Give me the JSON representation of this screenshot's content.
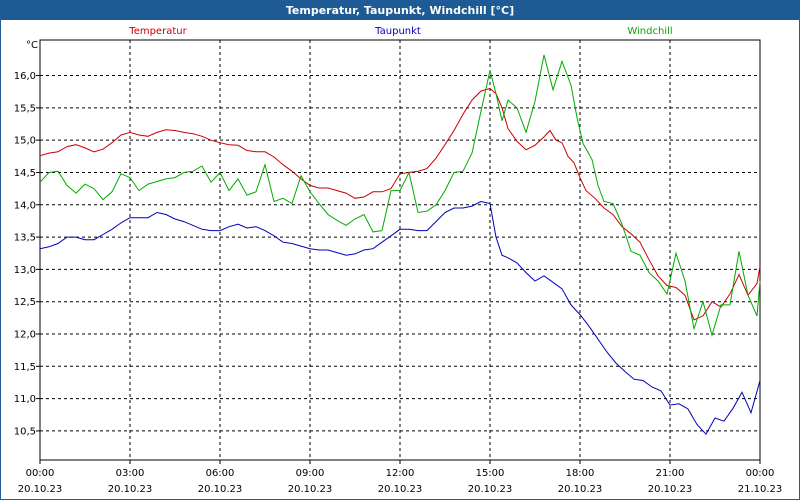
{
  "window": {
    "title": "Temperatur, Taupunkt, Windchill [°C]"
  },
  "chart_data": {
    "type": "line",
    "title": "Temperatur, Taupunkt, Windchill [°C]",
    "ylabel": "°C",
    "ylim": [
      10.05,
      16.55
    ],
    "yticks": [
      10.5,
      11.0,
      11.5,
      12.0,
      12.5,
      13.0,
      13.5,
      14.0,
      14.5,
      15.0,
      15.5,
      16.0
    ],
    "ytick_labels": [
      "10,5",
      "11,0",
      "11,5",
      "12,0",
      "12,5",
      "13,0",
      "13,5",
      "14,0",
      "14,5",
      "15,0",
      "15,5",
      "16,0"
    ],
    "xlim": [
      0,
      24
    ],
    "xticks": [
      0,
      3,
      6,
      9,
      12,
      15,
      18,
      21,
      24
    ],
    "xtick_labels": [
      {
        "time": "00:00",
        "date": "20.10.23"
      },
      {
        "time": "03:00",
        "date": "20.10.23"
      },
      {
        "time": "06:00",
        "date": "20.10.23"
      },
      {
        "time": "09:00",
        "date": "20.10.23"
      },
      {
        "time": "12:00",
        "date": "20.10.23"
      },
      {
        "time": "15:00",
        "date": "20.10.23"
      },
      {
        "time": "18:00",
        "date": "20.10.23"
      },
      {
        "time": "21:00",
        "date": "20.10.23"
      },
      {
        "time": "00:00",
        "date": "21.10.23"
      }
    ],
    "grid": true,
    "legend_position": "top",
    "series": [
      {
        "name": "Temperatur",
        "color": "#cc0000",
        "points": [
          [
            0.0,
            14.76
          ],
          [
            0.3,
            14.8
          ],
          [
            0.6,
            14.82
          ],
          [
            0.9,
            14.9
          ],
          [
            1.2,
            14.93
          ],
          [
            1.5,
            14.88
          ],
          [
            1.8,
            14.82
          ],
          [
            2.1,
            14.86
          ],
          [
            2.4,
            14.96
          ],
          [
            2.7,
            15.08
          ],
          [
            3.0,
            15.12
          ],
          [
            3.3,
            15.08
          ],
          [
            3.6,
            15.06
          ],
          [
            3.9,
            15.12
          ],
          [
            4.2,
            15.16
          ],
          [
            4.5,
            15.15
          ],
          [
            4.8,
            15.12
          ],
          [
            5.1,
            15.1
          ],
          [
            5.4,
            15.06
          ],
          [
            5.7,
            15.0
          ],
          [
            6.0,
            14.96
          ],
          [
            6.3,
            14.93
          ],
          [
            6.6,
            14.92
          ],
          [
            6.9,
            14.84
          ],
          [
            7.2,
            14.82
          ],
          [
            7.5,
            14.82
          ],
          [
            7.8,
            14.74
          ],
          [
            8.1,
            14.62
          ],
          [
            8.4,
            14.52
          ],
          [
            8.7,
            14.4
          ],
          [
            9.0,
            14.3
          ],
          [
            9.3,
            14.26
          ],
          [
            9.6,
            14.26
          ],
          [
            9.9,
            14.22
          ],
          [
            10.2,
            14.18
          ],
          [
            10.5,
            14.1
          ],
          [
            10.8,
            14.12
          ],
          [
            11.1,
            14.2
          ],
          [
            11.4,
            14.2
          ],
          [
            11.7,
            14.25
          ],
          [
            12.0,
            14.48
          ],
          [
            12.3,
            14.5
          ],
          [
            12.6,
            14.52
          ],
          [
            12.9,
            14.56
          ],
          [
            13.2,
            14.72
          ],
          [
            13.5,
            14.93
          ],
          [
            13.8,
            15.15
          ],
          [
            14.1,
            15.4
          ],
          [
            14.4,
            15.62
          ],
          [
            14.7,
            15.76
          ],
          [
            15.0,
            15.8
          ],
          [
            15.2,
            15.72
          ],
          [
            15.4,
            15.5
          ],
          [
            15.6,
            15.18
          ],
          [
            15.9,
            14.98
          ],
          [
            16.2,
            14.85
          ],
          [
            16.5,
            14.92
          ],
          [
            16.8,
            15.05
          ],
          [
            17.0,
            15.15
          ],
          [
            17.2,
            15.0
          ],
          [
            17.4,
            14.96
          ],
          [
            17.6,
            14.75
          ],
          [
            17.8,
            14.65
          ],
          [
            18.0,
            14.42
          ],
          [
            18.2,
            14.22
          ],
          [
            18.5,
            14.1
          ],
          [
            18.8,
            13.95
          ],
          [
            19.1,
            13.85
          ],
          [
            19.4,
            13.66
          ],
          [
            19.7,
            13.55
          ],
          [
            20.0,
            13.42
          ],
          [
            20.3,
            13.15
          ],
          [
            20.6,
            12.9
          ],
          [
            20.9,
            12.75
          ],
          [
            21.2,
            12.72
          ],
          [
            21.5,
            12.6
          ],
          [
            21.8,
            12.22
          ],
          [
            22.1,
            12.28
          ],
          [
            22.4,
            12.5
          ],
          [
            22.7,
            12.42
          ],
          [
            23.0,
            12.62
          ],
          [
            23.3,
            12.92
          ],
          [
            23.6,
            12.6
          ],
          [
            23.9,
            12.78
          ],
          [
            24.0,
            13.05
          ]
        ]
      },
      {
        "name": "Taupunkt",
        "color": "#0000bb",
        "points": [
          [
            0.0,
            13.32
          ],
          [
            0.3,
            13.35
          ],
          [
            0.6,
            13.4
          ],
          [
            0.9,
            13.5
          ],
          [
            1.2,
            13.5
          ],
          [
            1.5,
            13.46
          ],
          [
            1.8,
            13.46
          ],
          [
            2.1,
            13.54
          ],
          [
            2.4,
            13.62
          ],
          [
            2.7,
            13.72
          ],
          [
            3.0,
            13.8
          ],
          [
            3.3,
            13.8
          ],
          [
            3.6,
            13.8
          ],
          [
            3.9,
            13.88
          ],
          [
            4.2,
            13.85
          ],
          [
            4.5,
            13.78
          ],
          [
            4.8,
            13.74
          ],
          [
            5.1,
            13.68
          ],
          [
            5.4,
            13.62
          ],
          [
            5.7,
            13.6
          ],
          [
            6.0,
            13.6
          ],
          [
            6.3,
            13.66
          ],
          [
            6.6,
            13.7
          ],
          [
            6.9,
            13.64
          ],
          [
            7.2,
            13.66
          ],
          [
            7.5,
            13.6
          ],
          [
            7.8,
            13.52
          ],
          [
            8.1,
            13.42
          ],
          [
            8.4,
            13.4
          ],
          [
            8.7,
            13.36
          ],
          [
            9.0,
            13.32
          ],
          [
            9.3,
            13.3
          ],
          [
            9.6,
            13.3
          ],
          [
            9.9,
            13.26
          ],
          [
            10.2,
            13.22
          ],
          [
            10.5,
            13.24
          ],
          [
            10.8,
            13.3
          ],
          [
            11.1,
            13.32
          ],
          [
            11.4,
            13.42
          ],
          [
            11.7,
            13.52
          ],
          [
            12.0,
            13.62
          ],
          [
            12.3,
            13.62
          ],
          [
            12.6,
            13.6
          ],
          [
            12.9,
            13.6
          ],
          [
            13.2,
            13.74
          ],
          [
            13.5,
            13.88
          ],
          [
            13.8,
            13.95
          ],
          [
            14.1,
            13.95
          ],
          [
            14.4,
            13.98
          ],
          [
            14.7,
            14.05
          ],
          [
            15.0,
            14.02
          ],
          [
            15.2,
            13.5
          ],
          [
            15.4,
            13.22
          ],
          [
            15.6,
            13.18
          ],
          [
            15.9,
            13.1
          ],
          [
            16.2,
            12.95
          ],
          [
            16.5,
            12.82
          ],
          [
            16.8,
            12.9
          ],
          [
            17.1,
            12.8
          ],
          [
            17.4,
            12.7
          ],
          [
            17.7,
            12.45
          ],
          [
            18.0,
            12.3
          ],
          [
            18.3,
            12.12
          ],
          [
            18.6,
            11.92
          ],
          [
            18.9,
            11.72
          ],
          [
            19.2,
            11.55
          ],
          [
            19.5,
            11.42
          ],
          [
            19.8,
            11.3
          ],
          [
            20.1,
            11.28
          ],
          [
            20.4,
            11.18
          ],
          [
            20.7,
            11.12
          ],
          [
            21.0,
            10.9
          ],
          [
            21.3,
            10.92
          ],
          [
            21.6,
            10.84
          ],
          [
            21.9,
            10.6
          ],
          [
            22.2,
            10.45
          ],
          [
            22.5,
            10.7
          ],
          [
            22.8,
            10.65
          ],
          [
            23.1,
            10.85
          ],
          [
            23.4,
            11.1
          ],
          [
            23.7,
            10.78
          ],
          [
            24.0,
            11.28
          ]
        ]
      },
      {
        "name": "Windchill",
        "color": "#00aa00",
        "points": [
          [
            0.0,
            14.35
          ],
          [
            0.3,
            14.5
          ],
          [
            0.6,
            14.52
          ],
          [
            0.9,
            14.3
          ],
          [
            1.2,
            14.18
          ],
          [
            1.5,
            14.32
          ],
          [
            1.8,
            14.25
          ],
          [
            2.1,
            14.08
          ],
          [
            2.4,
            14.2
          ],
          [
            2.7,
            14.48
          ],
          [
            3.0,
            14.42
          ],
          [
            3.3,
            14.22
          ],
          [
            3.6,
            14.32
          ],
          [
            3.9,
            14.36
          ],
          [
            4.2,
            14.4
          ],
          [
            4.5,
            14.42
          ],
          [
            4.8,
            14.5
          ],
          [
            5.1,
            14.52
          ],
          [
            5.4,
            14.6
          ],
          [
            5.7,
            14.35
          ],
          [
            6.0,
            14.5
          ],
          [
            6.3,
            14.22
          ],
          [
            6.6,
            14.4
          ],
          [
            6.9,
            14.15
          ],
          [
            7.2,
            14.2
          ],
          [
            7.5,
            14.62
          ],
          [
            7.8,
            14.05
          ],
          [
            8.1,
            14.1
          ],
          [
            8.4,
            14.02
          ],
          [
            8.7,
            14.45
          ],
          [
            9.0,
            14.2
          ],
          [
            9.3,
            14.02
          ],
          [
            9.6,
            13.85
          ],
          [
            9.9,
            13.76
          ],
          [
            10.2,
            13.68
          ],
          [
            10.5,
            13.78
          ],
          [
            10.8,
            13.85
          ],
          [
            11.1,
            13.58
          ],
          [
            11.4,
            13.6
          ],
          [
            11.7,
            14.22
          ],
          [
            12.0,
            14.22
          ],
          [
            12.3,
            14.5
          ],
          [
            12.6,
            13.88
          ],
          [
            12.9,
            13.9
          ],
          [
            13.2,
            14.0
          ],
          [
            13.5,
            14.22
          ],
          [
            13.8,
            14.5
          ],
          [
            14.1,
            14.52
          ],
          [
            14.4,
            14.8
          ],
          [
            14.7,
            15.45
          ],
          [
            15.0,
            16.08
          ],
          [
            15.2,
            15.72
          ],
          [
            15.4,
            15.3
          ],
          [
            15.6,
            15.62
          ],
          [
            15.9,
            15.5
          ],
          [
            16.2,
            15.12
          ],
          [
            16.5,
            15.6
          ],
          [
            16.8,
            16.32
          ],
          [
            17.1,
            15.78
          ],
          [
            17.4,
            16.22
          ],
          [
            17.7,
            15.85
          ],
          [
            17.9,
            15.35
          ],
          [
            18.1,
            14.95
          ],
          [
            18.4,
            14.7
          ],
          [
            18.6,
            14.3
          ],
          [
            18.8,
            14.05
          ],
          [
            19.1,
            14.02
          ],
          [
            19.4,
            13.7
          ],
          [
            19.7,
            13.28
          ],
          [
            20.0,
            13.22
          ],
          [
            20.3,
            12.95
          ],
          [
            20.6,
            12.82
          ],
          [
            20.9,
            12.62
          ],
          [
            21.2,
            13.25
          ],
          [
            21.5,
            12.82
          ],
          [
            21.8,
            12.08
          ],
          [
            22.1,
            12.5
          ],
          [
            22.4,
            11.98
          ],
          [
            22.7,
            12.45
          ],
          [
            23.0,
            12.45
          ],
          [
            23.3,
            13.28
          ],
          [
            23.6,
            12.6
          ],
          [
            23.9,
            12.28
          ],
          [
            24.0,
            12.82
          ]
        ]
      }
    ]
  }
}
